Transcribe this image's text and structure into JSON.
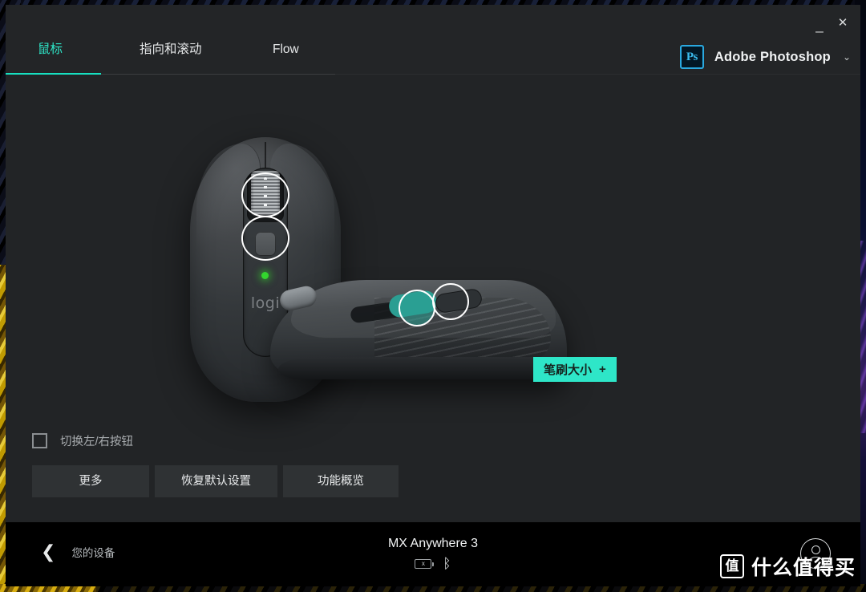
{
  "window": {
    "minimize_label": "_",
    "close_label": "✕"
  },
  "header": {
    "tabs": [
      {
        "label": "鼠标",
        "active": true
      },
      {
        "label": "指向和滚动",
        "active": false
      },
      {
        "label": "Flow",
        "active": false
      }
    ],
    "app_selector": {
      "icon_label": "Ps",
      "app_name": "Adobe Photoshop",
      "chevron": "⌄"
    }
  },
  "main": {
    "device_top_view": {
      "logo_text": "logi",
      "highlight_wheel": "scroll-wheel-ring",
      "highlight_mode": "mode-shift-button-ring"
    },
    "device_side_view": {
      "selected_button": "thumb-forward-button"
    },
    "action_badge": {
      "label": "笔刷大小",
      "modifier": "+",
      "color": "#2ee6c8"
    },
    "swap_buttons": {
      "label": "切换左/右按钮",
      "checked": false
    },
    "buttons": [
      {
        "label": "更多"
      },
      {
        "label": "恢复默认设置"
      },
      {
        "label": "功能概览"
      }
    ]
  },
  "footer": {
    "back_chevron": "❮",
    "back_label": "您的设备",
    "device_name": "MX Anywhere 3",
    "battery_status": "x",
    "bluetooth_icon": "ᛒ"
  },
  "watermark": {
    "logo": "值",
    "text": "什么值得买"
  }
}
